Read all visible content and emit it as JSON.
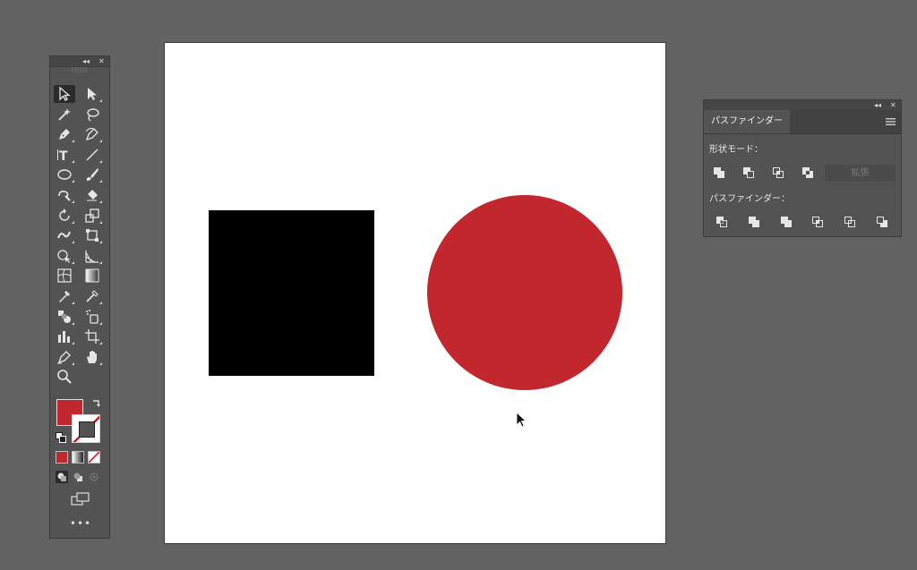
{
  "toolbar": {
    "collapse_glyph": "◂◂",
    "close_glyph": "✕",
    "grip_glyph": "||||||",
    "more_glyph": "•••",
    "tools": [
      {
        "name": "selection-tool-icon",
        "col": 0,
        "row": 0,
        "active": true
      },
      {
        "name": "direct-selection-tool-icon",
        "col": 1,
        "row": 0
      },
      {
        "name": "magic-wand-tool-icon",
        "col": 0,
        "row": 1
      },
      {
        "name": "lasso-tool-icon",
        "col": 1,
        "row": 1
      },
      {
        "name": "pen-tool-icon",
        "col": 0,
        "row": 2
      },
      {
        "name": "curvature-tool-icon",
        "col": 1,
        "row": 2
      },
      {
        "name": "type-tool-icon",
        "col": 0,
        "row": 3
      },
      {
        "name": "line-segment-tool-icon",
        "col": 1,
        "row": 3
      },
      {
        "name": "ellipse-tool-icon",
        "col": 0,
        "row": 4
      },
      {
        "name": "paintbrush-tool-icon",
        "col": 1,
        "row": 4
      },
      {
        "name": "shaper-tool-icon",
        "col": 0,
        "row": 5
      },
      {
        "name": "eraser-tool-icon",
        "col": 1,
        "row": 5
      },
      {
        "name": "rotate-tool-icon",
        "col": 0,
        "row": 6
      },
      {
        "name": "scale-tool-icon",
        "col": 1,
        "row": 6
      },
      {
        "name": "warp-tool-icon",
        "col": 0,
        "row": 7
      },
      {
        "name": "free-transform-tool-icon",
        "col": 1,
        "row": 7
      },
      {
        "name": "shape-builder-tool-icon",
        "col": 0,
        "row": 8
      },
      {
        "name": "perspective-grid-tool-icon",
        "col": 1,
        "row": 8
      },
      {
        "name": "mesh-tool-icon",
        "col": 0,
        "row": 9
      },
      {
        "name": "gradient-tool-icon",
        "col": 1,
        "row": 9
      },
      {
        "name": "eyedropper-tool-icon",
        "col": 0,
        "row": 10
      },
      {
        "name": "measure-tool-icon",
        "col": 1,
        "row": 10
      },
      {
        "name": "blend-tool-icon",
        "col": 0,
        "row": 11
      },
      {
        "name": "symbol-sprayer-tool-icon",
        "col": 1,
        "row": 11
      },
      {
        "name": "column-graph-tool-icon",
        "col": 0,
        "row": 12
      },
      {
        "name": "artboard-tool-icon",
        "col": 1,
        "row": 12
      },
      {
        "name": "slice-tool-icon",
        "col": 0,
        "row": 13
      },
      {
        "name": "hand-tool-icon",
        "col": 1,
        "row": 13
      },
      {
        "name": "zoom-tool-icon",
        "col": 0,
        "row": 14
      }
    ],
    "fill_color": "#c1272d"
  },
  "artboard": {
    "rect_color": "#000000",
    "circle_color": "#c1272d"
  },
  "pathfinder": {
    "tab_label": "パスファインダー",
    "shape_modes_label": "形状モード：",
    "pathfinders_label": "パスファインダー：",
    "expand_label": "拡張"
  }
}
